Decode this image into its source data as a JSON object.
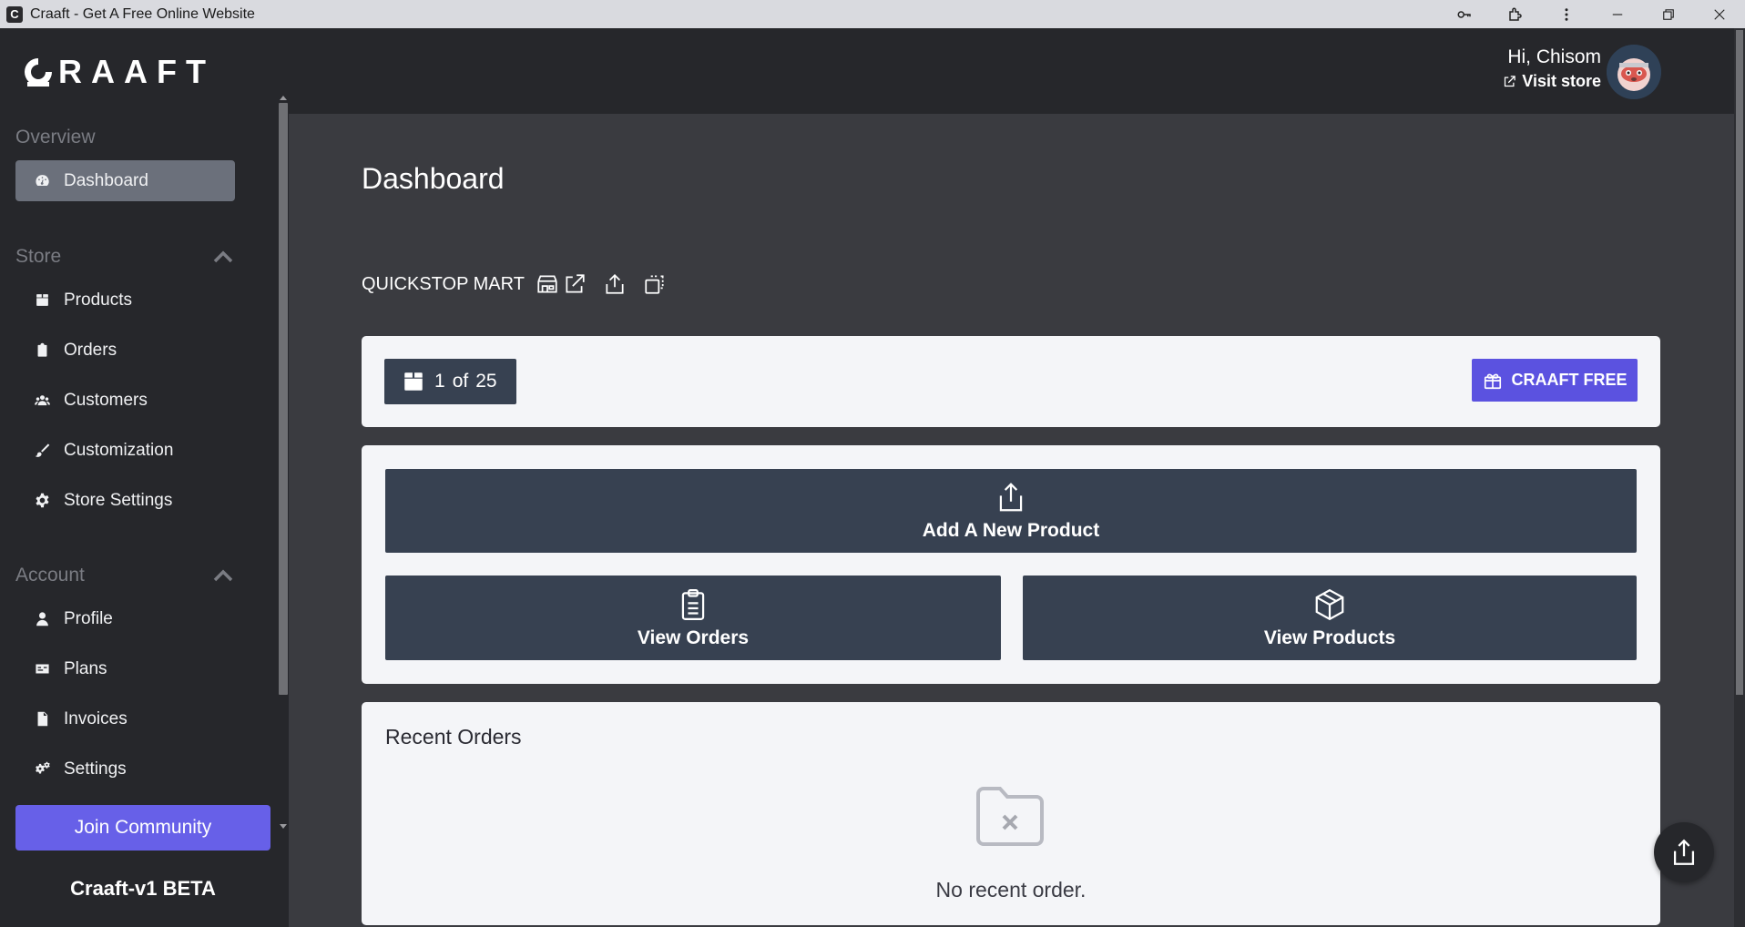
{
  "window": {
    "title": "Craaft - Get A Free Online Website"
  },
  "sidebar": {
    "logo_text": "RAAFT",
    "sections": {
      "overview": "Overview",
      "store": "Store",
      "account": "Account"
    },
    "items": {
      "dashboard": "Dashboard",
      "products": "Products",
      "orders": "Orders",
      "customers": "Customers",
      "customization": "Customization",
      "store_settings": "Store Settings",
      "profile": "Profile",
      "plans": "Plans",
      "invoices": "Invoices",
      "settings": "Settings"
    },
    "join_label": "Join Community",
    "version": "Craaft-v1 BETA"
  },
  "header": {
    "greeting": "Hi, Chisom",
    "visit_store": "Visit store"
  },
  "main": {
    "page_title": "Dashboard",
    "store_name": "QUICKSTOP MART",
    "usage": {
      "current": "1",
      "of": "of",
      "total": "25"
    },
    "plan_label": "CRAAFT FREE",
    "actions": {
      "add_product": "Add A New Product",
      "view_orders": "View Orders",
      "view_products": "View Products"
    },
    "recent": {
      "title": "Recent Orders",
      "empty": "No recent order."
    }
  },
  "colors": {
    "sidebar_bg": "#26272b",
    "content_bg": "#3a3b40",
    "accent": "#6760e8",
    "button_dark": "#374151"
  }
}
